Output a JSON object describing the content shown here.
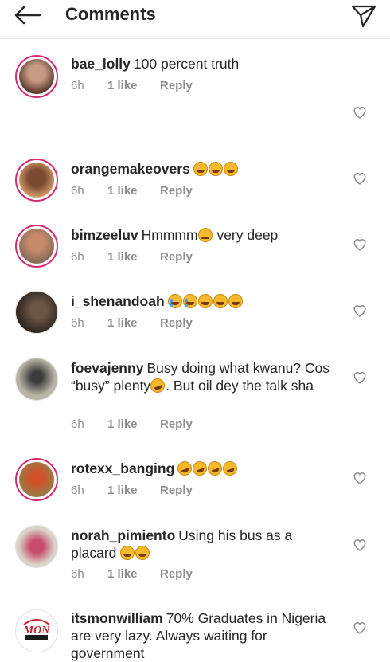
{
  "header": {
    "title": "Comments"
  },
  "comments": [
    {
      "username": "bae_lolly",
      "text": "100 percent truth",
      "time": "6h",
      "likes": "1 like",
      "reply": "Reply"
    },
    {
      "username": "orangemakeovers",
      "text": "",
      "time": "6h",
      "likes": "1 like",
      "reply": "Reply"
    },
    {
      "username": "bimzeeluv",
      "text": "Hmmmm",
      "text2": " very deep",
      "time": "6h",
      "likes": "1 like",
      "reply": "Reply"
    },
    {
      "username": "i_shenandoah",
      "text": "",
      "time": "6h",
      "likes": "1 like",
      "reply": "Reply"
    },
    {
      "username": "foevajenny",
      "text": "Busy doing what kwanu? Cos “busy” plenty",
      "text2": ". But oil dey the talk sha",
      "time": "6h",
      "likes": "1 like",
      "reply": "Reply"
    },
    {
      "username": "rotexx_banging",
      "text": "",
      "time": "6h",
      "likes": "1 like",
      "reply": "Reply"
    },
    {
      "username": "norah_pimiento",
      "text": "Using his bus as a placard",
      "time": "6h",
      "likes": "1 like",
      "reply": "Reply"
    },
    {
      "username": "itsmonwilliam",
      "text": "70% Graduates in Nigeria are very lazy. Always waiting for government",
      "time": "",
      "likes": "",
      "reply": ""
    }
  ],
  "icons": {
    "back": "arrow-left-icon",
    "send": "send-icon",
    "like": "heart-icon"
  },
  "colors": {
    "story_ring": "#d6296f",
    "meta_gray": "#8e8e8e",
    "text": "#262626"
  }
}
